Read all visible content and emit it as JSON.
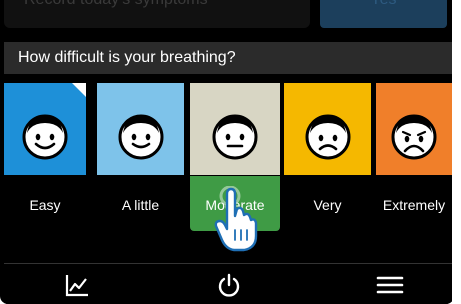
{
  "top": {
    "field_text": "Record today's symptoms",
    "button_label": "Yes"
  },
  "question": "How difficult is your breathing?",
  "options": [
    {
      "label": "Easy",
      "color": "#1e90d8",
      "mood": "happy"
    },
    {
      "label": "A little",
      "color": "#7ec3ea",
      "mood": "happy"
    },
    {
      "label": "Moderate",
      "color": "#d8d6c4",
      "mood": "neutral"
    },
    {
      "label": "Very",
      "color": "#f5b800",
      "mood": "sad"
    },
    {
      "label": "Extremely",
      "color": "#f07f2a",
      "mood": "sad"
    }
  ],
  "selected_option": "Moderate",
  "selected_color": "#3f9b45",
  "nav": {
    "items": [
      "chart-icon",
      "power-icon",
      "menu-icon"
    ]
  }
}
